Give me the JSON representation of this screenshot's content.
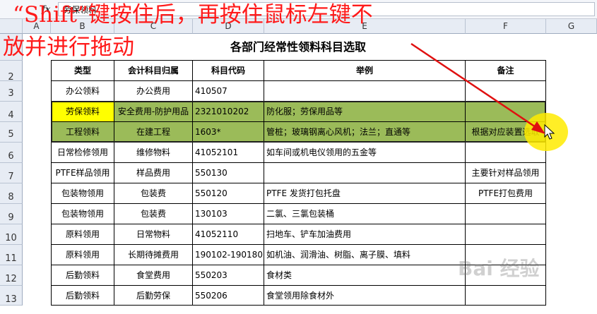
{
  "formula_bar": {
    "fx_label": "fx",
    "value": "劳保领料"
  },
  "columns": [
    "A",
    "B",
    "C",
    "D",
    "E",
    "F",
    "G"
  ],
  "rows": [
    "2",
    "3",
    "4",
    "5",
    "6",
    "7",
    "8",
    "9",
    "10",
    "11",
    "12",
    "13"
  ],
  "sheet": {
    "title": "各部门经常性领料科目选取",
    "headers": [
      "类型",
      "会计科目归属",
      "科目代码",
      "举例",
      "备注"
    ],
    "data": [
      [
        "办公领料",
        "办公费用",
        "410507",
        "",
        ""
      ],
      [
        "劳保领料",
        "安全费用-防护用品",
        "2321010202",
        "防化服；劳保用品等",
        ""
      ],
      [
        "工程领料",
        "在建工程",
        "1603*",
        "管桩；玻璃钢离心风机；法兰；直通等",
        "根据对应装置选取"
      ],
      [
        "日常检修领用",
        "维修物料",
        "41052101",
        "如车间或机电仪领用的五金等",
        ""
      ],
      [
        "PTFE样品领用",
        "样品费用",
        "550130",
        "",
        "主要针对样品领用"
      ],
      [
        "包装物领用",
        "包装费",
        "550120",
        "PTFE 发货打包托盘",
        "PTFE打包费用"
      ],
      [
        "包装物领用",
        "包装费",
        "130103",
        "二氯、三氯包装桶",
        ""
      ],
      [
        "原料领用",
        "日常物料",
        "41052110",
        "扫地车、铲车加油费用",
        ""
      ],
      [
        "原料领用",
        "长期待摊费用",
        "190102-190180",
        "如机油、润滑油、树脂、离子膜、填料",
        ""
      ],
      [
        "后勤领料",
        "食堂费用",
        "550203",
        "食材类",
        ""
      ],
      [
        "后勤领料",
        "后勤劳保",
        "550206",
        "食堂领用除食材外",
        ""
      ]
    ]
  },
  "annotation": {
    "line1": "“Shift”键按住后，再按住鼠标左键不",
    "line2": "放并进行拖动"
  },
  "colors": {
    "selection": "#9bbb59",
    "active_cell": "#ffff00",
    "annotation": "#ff1a1a"
  },
  "watermark": "Bai 经验"
}
